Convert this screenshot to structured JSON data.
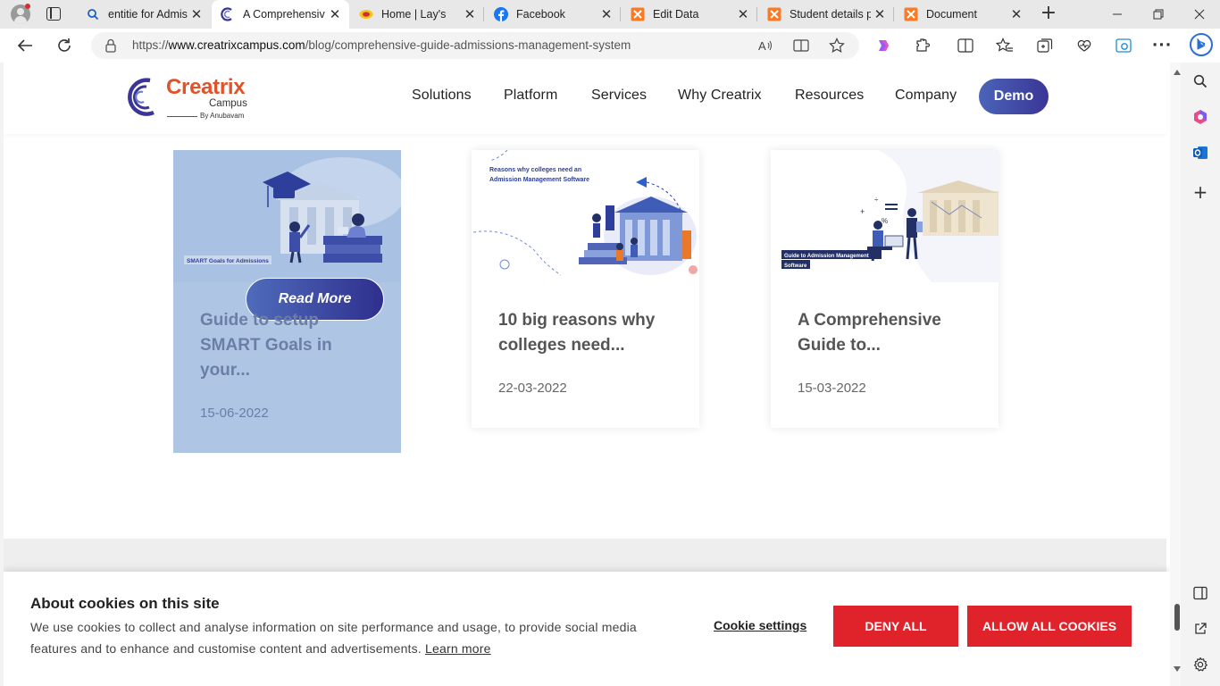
{
  "browser": {
    "tabs": [
      {
        "title": "entitie for Admis",
        "icon": "search-icon",
        "active": false
      },
      {
        "title": "A Comprehensiv",
        "icon": "creatrix-icon",
        "active": true
      },
      {
        "title": "Home | Lay's",
        "icon": "lays-icon",
        "active": false
      },
      {
        "title": "Facebook",
        "icon": "facebook-icon",
        "active": false
      },
      {
        "title": "Edit Data",
        "icon": "xampp-icon",
        "active": false
      },
      {
        "title": "Student details p",
        "icon": "xampp-icon",
        "active": false
      },
      {
        "title": "Document",
        "icon": "xampp-icon",
        "active": false
      }
    ],
    "url_prefix": "https://",
    "url_host": "www.creatrixcampus.com",
    "url_path": "/blog/comprehensive-guide-admissions-management-system"
  },
  "site": {
    "logo_name": "Creatrix",
    "logo_sub": "Campus",
    "logo_by": "By Anubavam",
    "nav": [
      "Solutions",
      "Platform",
      "Services",
      "Why Creatrix",
      "Resources",
      "Company"
    ],
    "demo_label": "Demo"
  },
  "cards": [
    {
      "thumb_caption": "SMART Goals for Admissions",
      "title": "Guide to setup SMART Goals in your...",
      "date": "15-06-2022",
      "read_more": "Read More"
    },
    {
      "thumb_caption_1": "Reasons why colleges need an",
      "thumb_caption_2": "Admission Management Software",
      "title": "10 big reasons why colleges need...",
      "date": "22-03-2022"
    },
    {
      "thumb_caption_1": "Guide to Admission Management",
      "thumb_caption_2": "Software",
      "title": "A Comprehensive Guide to...",
      "date": "15-03-2022"
    }
  ],
  "cookie": {
    "title": "About cookies on this site",
    "text": "We use cookies to collect and analyse information on site performance and usage, to provide social media features and to enhance and customise content and advertisements.",
    "learn_more": "Learn more",
    "settings": "Cookie settings",
    "deny": "DENY ALL",
    "allow": "ALLOW ALL COOKIES"
  },
  "colors": {
    "accent_red": "#e0222a",
    "brand_orange": "#e0532a",
    "brand_blue": "#3a3596",
    "hover_card": "#aec6e4"
  }
}
